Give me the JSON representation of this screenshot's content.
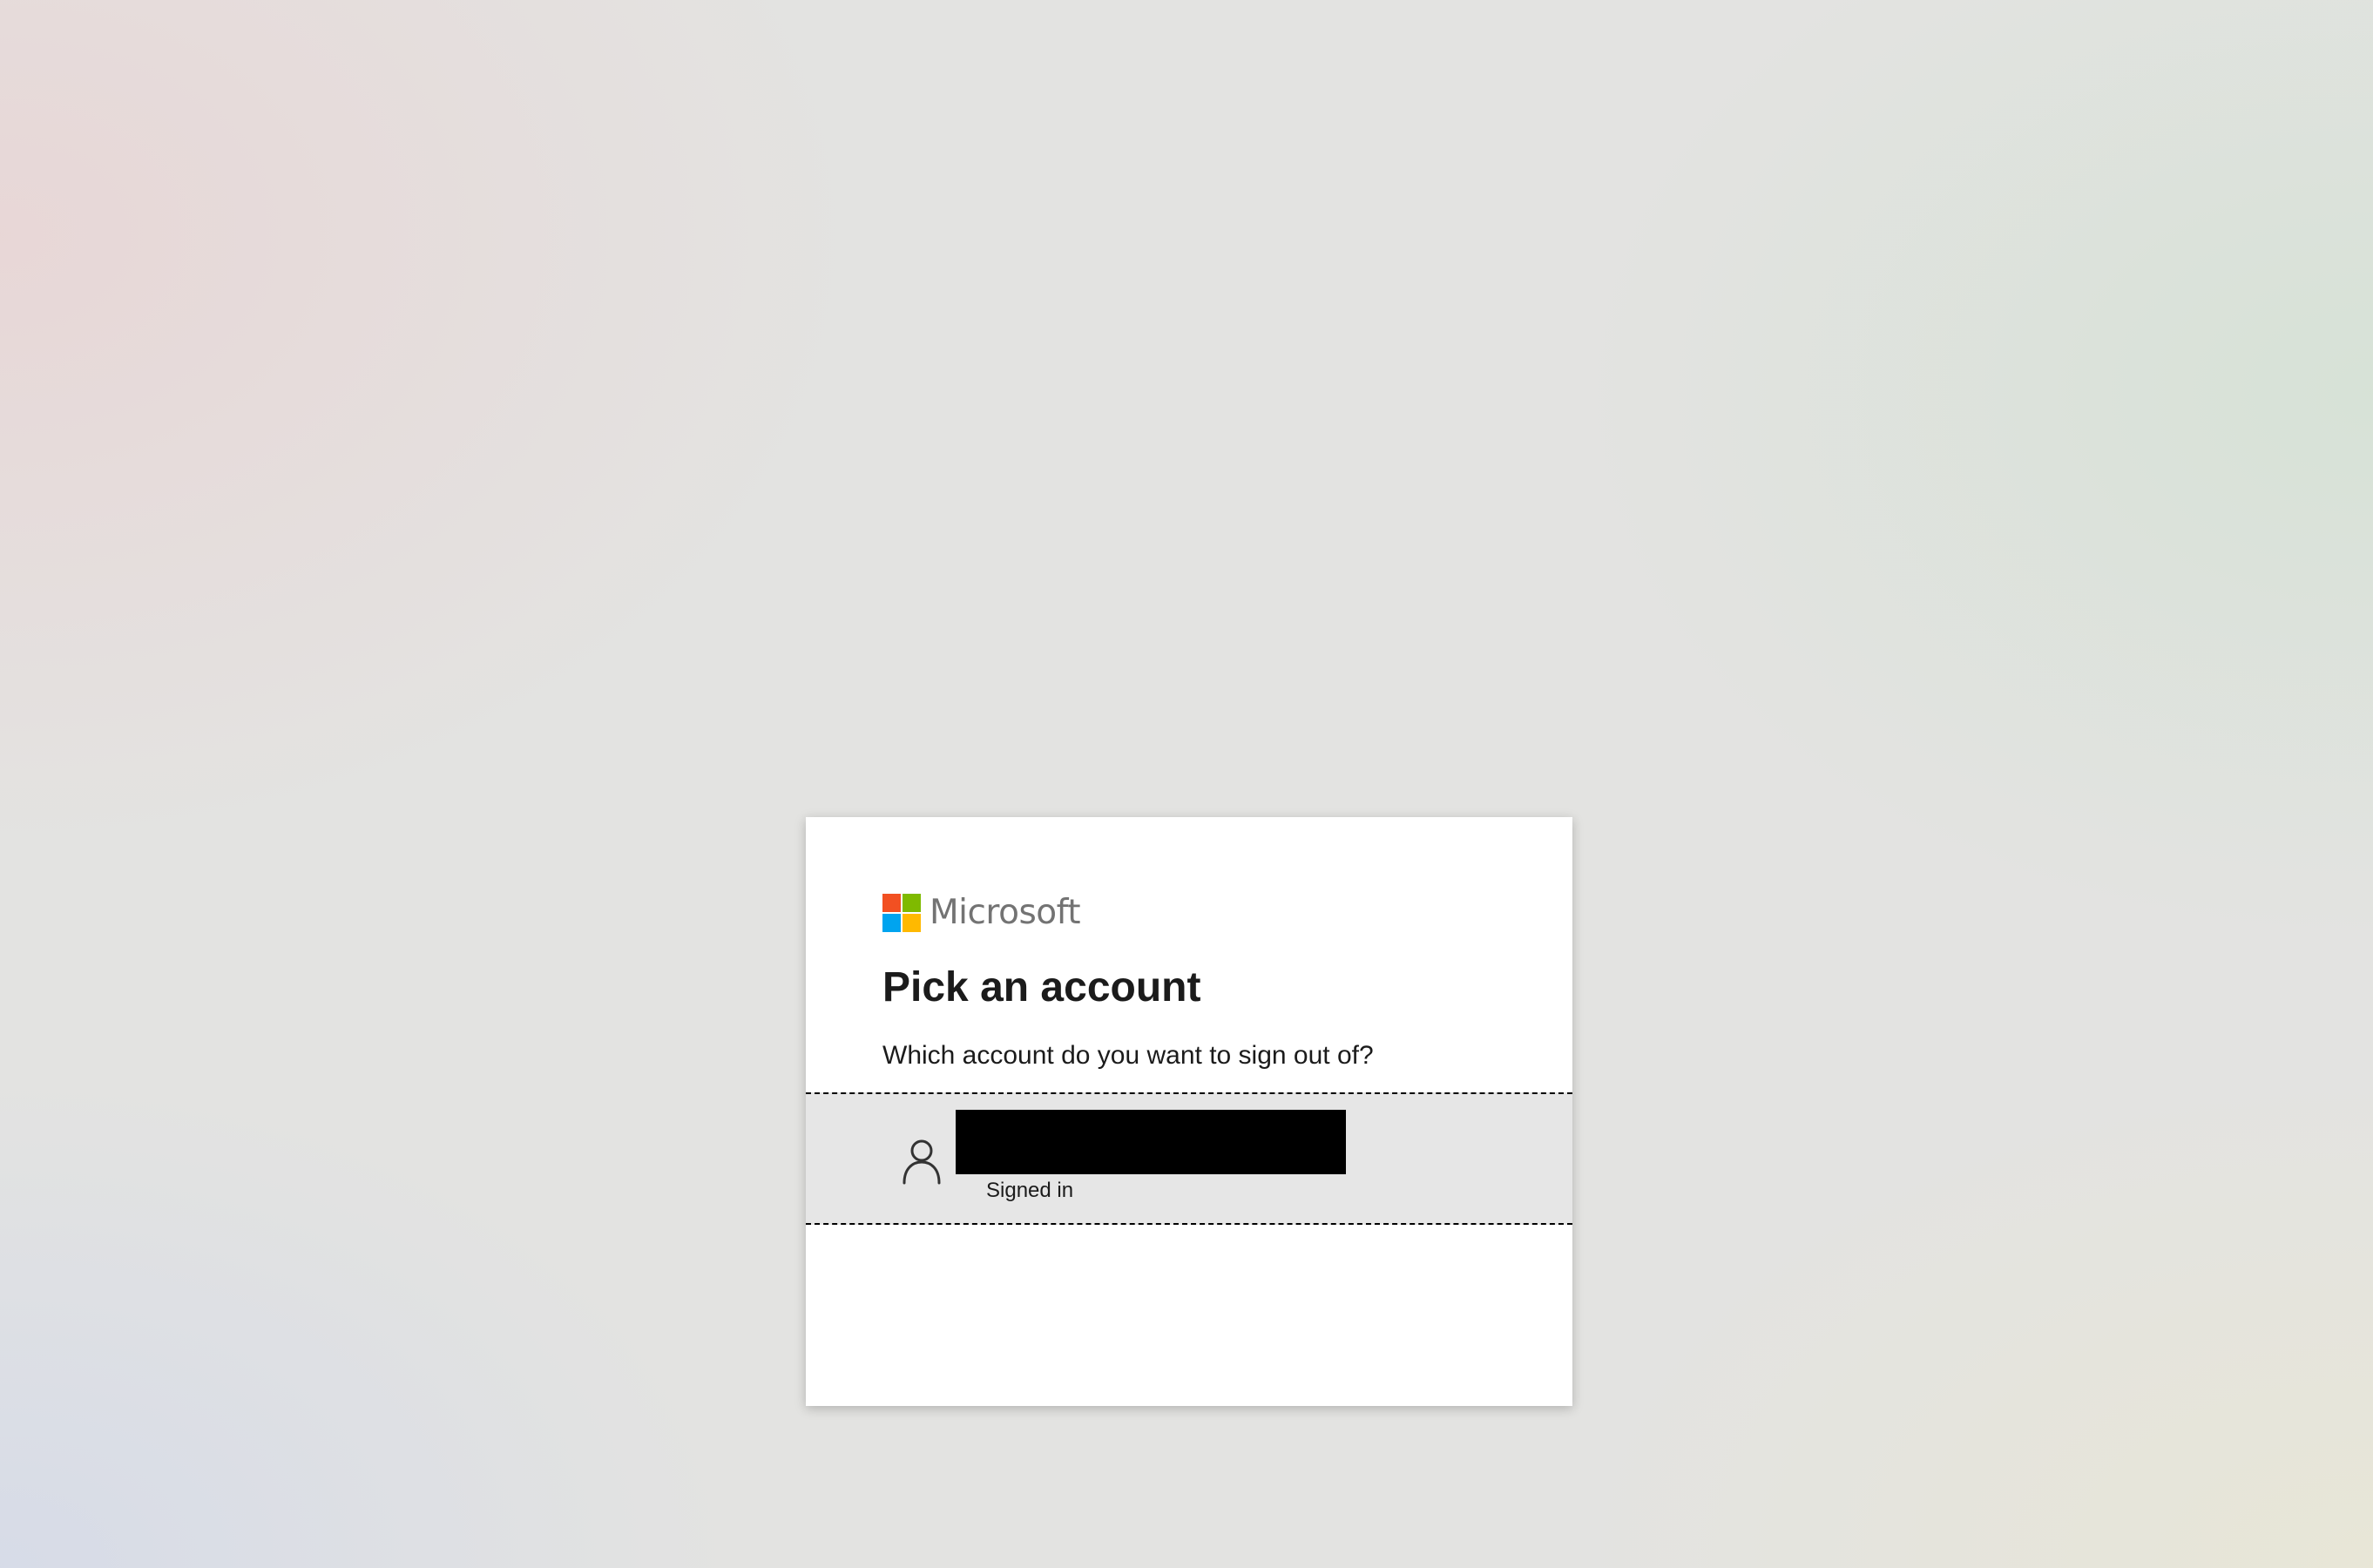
{
  "brand": {
    "name": "Microsoft",
    "logo_colors": [
      "#f25022",
      "#7fba00",
      "#00a4ef",
      "#ffb900"
    ]
  },
  "heading": {
    "title": "Pick an account",
    "subtitle": "Which account do you want to sign out of?"
  },
  "accounts": [
    {
      "icon": "person-icon",
      "email_redacted": true,
      "status": "Signed in"
    }
  ]
}
